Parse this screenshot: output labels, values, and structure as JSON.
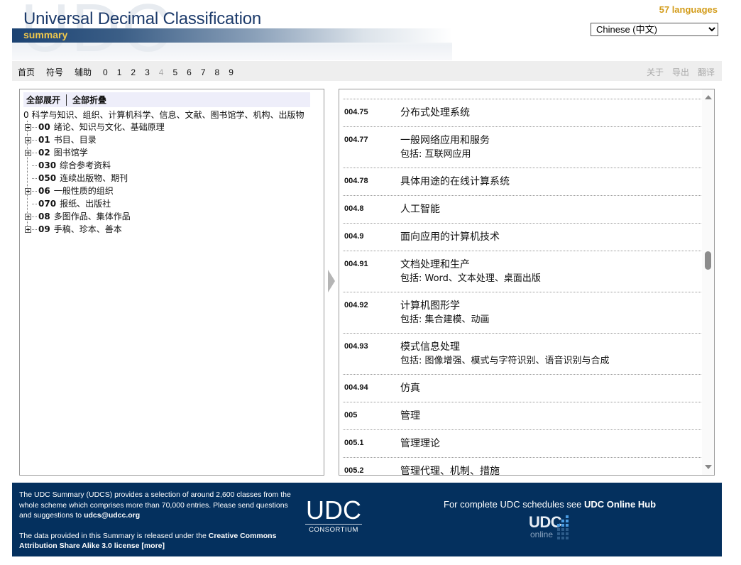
{
  "header": {
    "watermark": "UDC",
    "title": "Universal Decimal Classification",
    "subtitle": "summary",
    "language_count": "57 languages",
    "language_select": {
      "selected": "Chinese (中文)"
    }
  },
  "nav": {
    "links": [
      "首页",
      "符号",
      "辅助"
    ],
    "digits": [
      {
        "label": "0",
        "enabled": true
      },
      {
        "label": "1",
        "enabled": true
      },
      {
        "label": "2",
        "enabled": true
      },
      {
        "label": "3",
        "enabled": true
      },
      {
        "label": "4",
        "enabled": false
      },
      {
        "label": "5",
        "enabled": true
      },
      {
        "label": "6",
        "enabled": true
      },
      {
        "label": "7",
        "enabled": true
      },
      {
        "label": "8",
        "enabled": true
      },
      {
        "label": "9",
        "enabled": true
      }
    ],
    "right_links": [
      "关于",
      "导出",
      "翻译"
    ]
  },
  "tree": {
    "expand_all": "全部展开",
    "collapse_all": "全部折叠",
    "root": {
      "code": "0",
      "label": "科学与知识、组织、计算机科学、信息、文献、图书馆学、机构、出版物"
    },
    "items": [
      {
        "code": "00",
        "label": "绪论、知识与文化、基础原理",
        "expandable": true
      },
      {
        "code": "01",
        "label": "书目、目录",
        "expandable": true
      },
      {
        "code": "02",
        "label": "图书馆学",
        "expandable": true
      },
      {
        "code": "030",
        "label": "综合参考资料",
        "expandable": false
      },
      {
        "code": "050",
        "label": "连续出版物、期刊",
        "expandable": false
      },
      {
        "code": "06",
        "label": "一般性质的组织",
        "expandable": true
      },
      {
        "code": "070",
        "label": "报纸、出版社",
        "expandable": false
      },
      {
        "code": "08",
        "label": "多图作品、集体作品",
        "expandable": true
      },
      {
        "code": "09",
        "label": "手稿、珍本、善本",
        "expandable": true
      }
    ]
  },
  "entries": [
    {
      "code": "004.75",
      "title": "分布式处理系统",
      "including": null
    },
    {
      "code": "004.77",
      "title": "一般网络应用和服务",
      "including": "包括: 互联网应用"
    },
    {
      "code": "004.78",
      "title": "具体用途的在线计算系统",
      "including": null
    },
    {
      "code": "004.8",
      "title": "人工智能",
      "including": null
    },
    {
      "code": "004.9",
      "title": "面向应用的计算机技术",
      "including": null
    },
    {
      "code": "004.91",
      "title": "文档处理和生产",
      "including": "包括: Word、文本处理、桌面出版"
    },
    {
      "code": "004.92",
      "title": "计算机图形学",
      "including": "包括: 集合建模、动画"
    },
    {
      "code": "004.93",
      "title": "模式信息处理",
      "including": "包括: 图像增强、模式与字符识别、语音识别与合成"
    },
    {
      "code": "004.94",
      "title": "仿真",
      "including": null
    },
    {
      "code": "005",
      "title": "管理",
      "including": null
    },
    {
      "code": "005.1",
      "title": "管理理论",
      "including": null
    },
    {
      "code": "005.2",
      "title": "管理代理、机制、措施",
      "including": null
    }
  ],
  "footer": {
    "para1_text": "The UDC Summary (UDCS) provides a selection of around 2,600 classes from the whole scheme which comprises more than 70,000 entries. Please send questions and suggestions to ",
    "email": "udcs@udcc.org",
    "para2_text": "The data provided in this Summary is released under the ",
    "license_link": "Creative Commons Attribution Share Alike 3.0 license",
    "more_link": "[more]",
    "consortium_logo": "UDC",
    "consortium_sub": "CONSORTIUM",
    "online_text": "For complete UDC schedules see ",
    "online_link": "UDC Online Hub",
    "online_logo_main": "UDC",
    "online_logo_sub": "online"
  },
  "colors": {
    "brand_navy": "#04305e",
    "accent_gold": "#d39c1a",
    "title_blue": "#1d3b6b"
  }
}
